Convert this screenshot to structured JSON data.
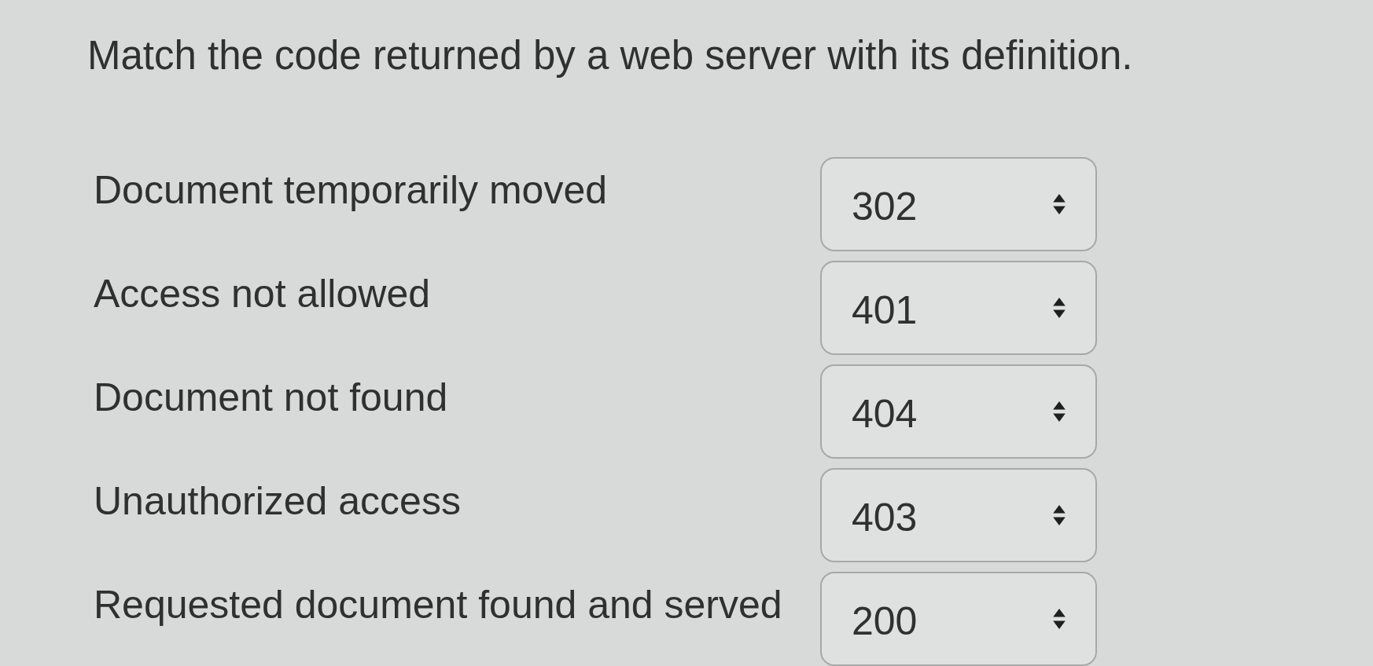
{
  "question": "Match the code returned by a web server with its definition.",
  "rows": [
    {
      "definition": "Document temporarily moved",
      "value": "302"
    },
    {
      "definition": "Access not allowed",
      "value": "401"
    },
    {
      "definition": "Document not found",
      "value": "404"
    },
    {
      "definition": "Unauthorized access",
      "value": "403"
    },
    {
      "definition": "Requested document found and served",
      "value": "200"
    }
  ]
}
